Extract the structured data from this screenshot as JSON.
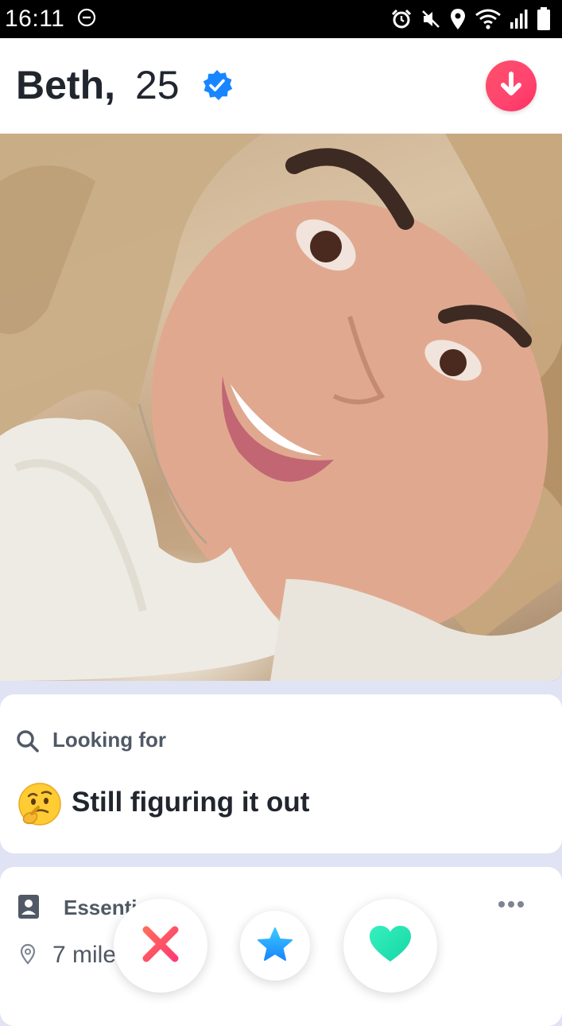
{
  "status_bar": {
    "time": "16:11",
    "icons": [
      "do-not-disturb-icon",
      "alarm-icon",
      "mute-icon",
      "location-icon",
      "wifi-icon",
      "signal-icon",
      "battery-icon"
    ]
  },
  "profile": {
    "name": "Beth,",
    "age": "25",
    "verified": true,
    "verified_color": "#1786ff",
    "collapse_icon": "arrow-down-icon"
  },
  "photo": {
    "description_icon": "profile-photo"
  },
  "looking_for": {
    "label": "Looking for",
    "icon": "search-icon",
    "emoji": "thinking-face-emoji",
    "value": "Still figuring it out"
  },
  "essentials": {
    "label": "Essenti",
    "icon": "id-card-icon",
    "more_icon": "more-icon",
    "distance": "7 mile",
    "distance_icon": "location-pin-icon"
  },
  "actions": [
    {
      "name": "nope",
      "icon": "x-icon",
      "color": "#fe3c72"
    },
    {
      "name": "super-like",
      "icon": "star-icon",
      "color": "#1ea4ff"
    },
    {
      "name": "like",
      "icon": "heart-icon",
      "color": "#22e5b2"
    }
  ],
  "colors": {
    "brand_gradient_start": "#fd5068",
    "brand_gradient_end": "#ff2f5e",
    "background": "#dfe3f3",
    "text": "#21262e",
    "muted_text": "#505965"
  }
}
